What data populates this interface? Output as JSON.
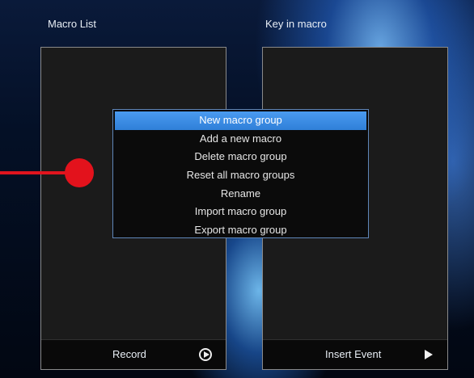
{
  "panels": {
    "left": {
      "title": "Macro List",
      "footer_label": "Record",
      "footer_icon": "play-circle-icon"
    },
    "right": {
      "title": "Key in macro",
      "footer_label": "Insert Event",
      "footer_icon": "play-triangle-icon"
    }
  },
  "context_menu": {
    "items": [
      {
        "label": "New macro group",
        "selected": true
      },
      {
        "label": "Add a new macro"
      },
      {
        "label": "Delete macro group"
      },
      {
        "label": "Reset all macro groups"
      },
      {
        "label": "Rename"
      },
      {
        "label": "Import macro group"
      },
      {
        "label": "Export macro group"
      }
    ],
    "highlight_color": "#3b8ce6",
    "border_color": "#5f86b8"
  },
  "annotation": {
    "marker_color": "#e3121c"
  }
}
